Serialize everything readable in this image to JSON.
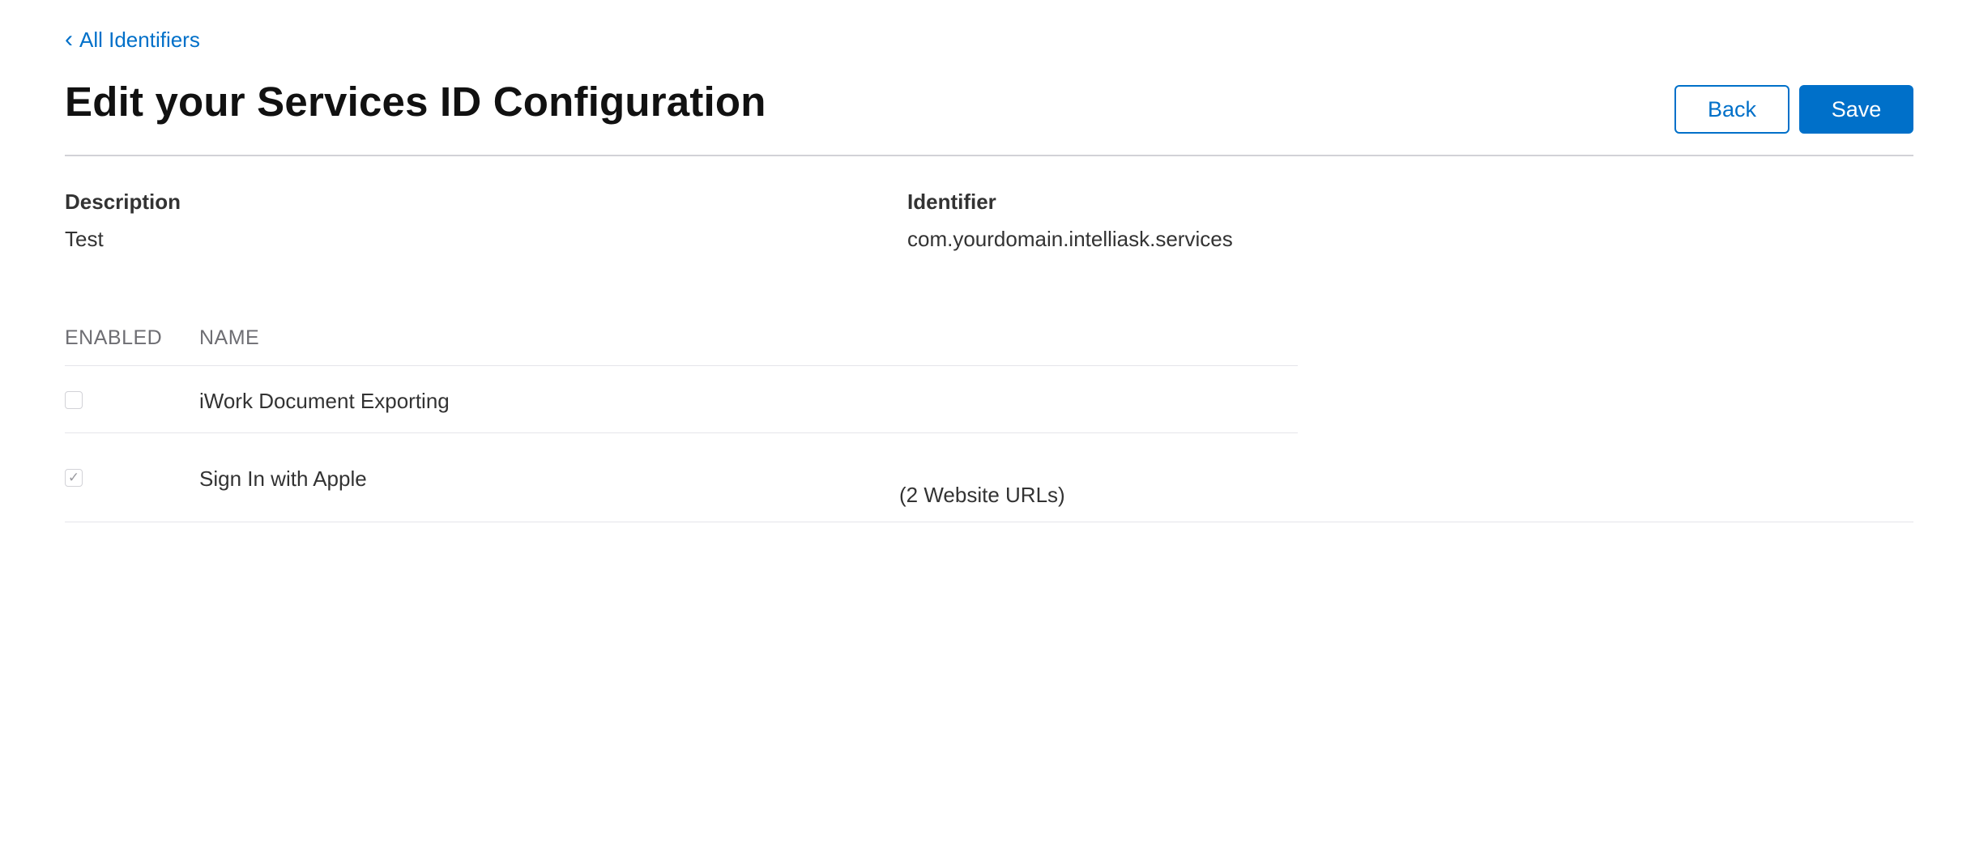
{
  "nav": {
    "back_label": "All Identifiers"
  },
  "header": {
    "title": "Edit your Services ID Configuration",
    "back_button": "Back",
    "save_button": "Save"
  },
  "details": {
    "description_label": "Description",
    "description_value": "Test",
    "identifier_label": "Identifier",
    "identifier_value": "com.yourdomain.intelliask.services"
  },
  "capabilities": {
    "columns": [
      "ENABLED",
      "NAME"
    ],
    "rows": [
      {
        "name": "iWork Document Exporting",
        "enabled": false,
        "detail": ""
      },
      {
        "name": "Sign In with Apple",
        "enabled": true,
        "detail": "(2 Website URLs)"
      }
    ]
  },
  "colors": {
    "accent": "#0070c9",
    "text": "#333333",
    "muted": "#6e6e73",
    "rule": "#d2d2d7"
  }
}
